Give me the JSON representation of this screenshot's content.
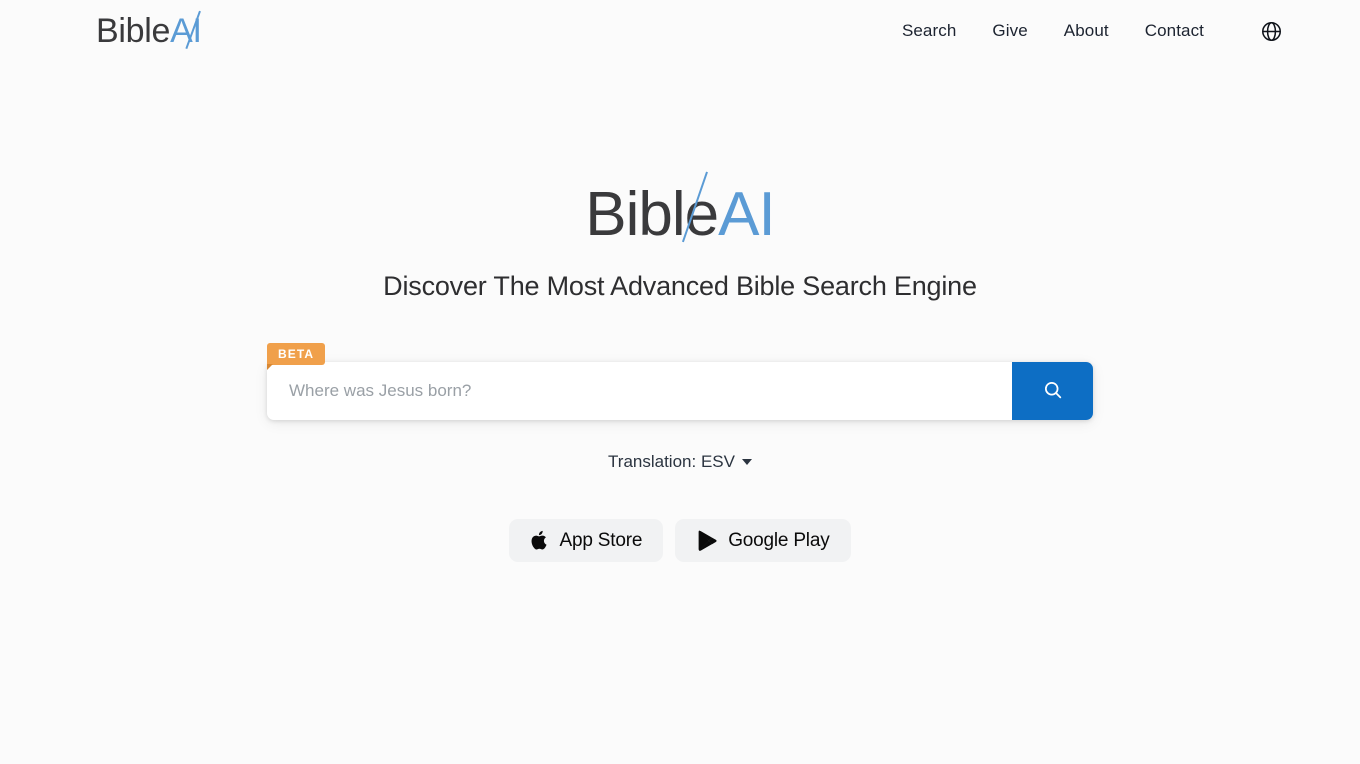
{
  "colors": {
    "background": "#fbfbfb",
    "brand_blue": "#5b9bd5",
    "button_blue": "#0d6ec4",
    "beta_orange": "#f0a04b",
    "text_dark": "#2b2b2b",
    "store_button_bg": "#f1f2f3"
  },
  "header": {
    "brand": {
      "primary": "Bible",
      "accent": "AI"
    },
    "nav": [
      {
        "label": "Search"
      },
      {
        "label": "Give"
      },
      {
        "label": "About"
      },
      {
        "label": "Contact"
      }
    ],
    "language_icon": "globe-icon"
  },
  "hero": {
    "logo": {
      "primary": "Bible",
      "accent": "AI"
    },
    "tagline": "Discover The Most Advanced Bible Search Engine"
  },
  "search": {
    "beta_label": "BETA",
    "placeholder": "Where was Jesus born?",
    "value": "",
    "submit_icon": "search-icon"
  },
  "translation": {
    "label": "Translation: ESV",
    "selected": "ESV",
    "caret_icon": "chevron-down-icon"
  },
  "stores": [
    {
      "label": "App Store",
      "icon": "apple-icon"
    },
    {
      "label": "Google Play",
      "icon": "google-play-icon"
    }
  ]
}
